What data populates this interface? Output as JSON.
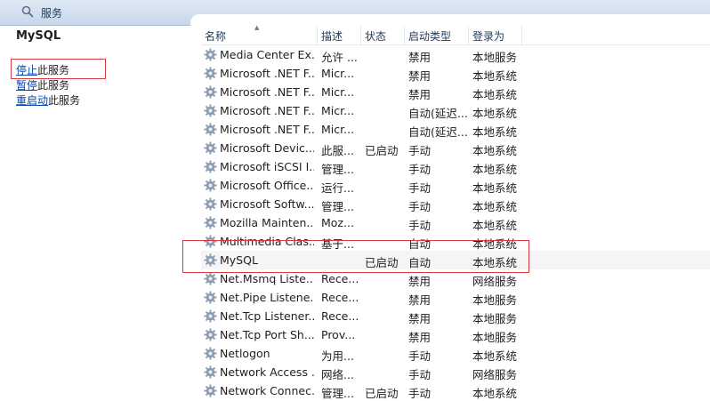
{
  "window": {
    "title": "服务"
  },
  "left_panel": {
    "service_name": "MySQL",
    "actions": [
      {
        "link": "停止",
        "rest": "此服务"
      },
      {
        "link": "暂停",
        "rest": "此服务"
      },
      {
        "link": "重启动",
        "rest": "此服务"
      }
    ]
  },
  "table": {
    "headers": {
      "name": "名称",
      "desc": "描述",
      "state": "状态",
      "startup": "启动类型",
      "logon": "登录为"
    },
    "rows": [
      {
        "name": "Media Center Ex...",
        "desc": "允许 ...",
        "state": "",
        "startup": "禁用",
        "logon": "本地服务"
      },
      {
        "name": "Microsoft .NET F...",
        "desc": "Micr...",
        "state": "",
        "startup": "禁用",
        "logon": "本地系统"
      },
      {
        "name": "Microsoft .NET F...",
        "desc": "Micr...",
        "state": "",
        "startup": "禁用",
        "logon": "本地系统"
      },
      {
        "name": "Microsoft .NET F...",
        "desc": "Micr...",
        "state": "",
        "startup": "自动(延迟...",
        "logon": "本地系统"
      },
      {
        "name": "Microsoft .NET F...",
        "desc": "Micr...",
        "state": "",
        "startup": "自动(延迟...",
        "logon": "本地系统"
      },
      {
        "name": "Microsoft Devic...",
        "desc": "此服...",
        "state": "已启动",
        "startup": "手动",
        "logon": "本地系统"
      },
      {
        "name": "Microsoft iSCSI I...",
        "desc": "管理...",
        "state": "",
        "startup": "手动",
        "logon": "本地系统"
      },
      {
        "name": "Microsoft Office...",
        "desc": "运行...",
        "state": "",
        "startup": "手动",
        "logon": "本地系统"
      },
      {
        "name": "Microsoft Softw...",
        "desc": "管理...",
        "state": "",
        "startup": "手动",
        "logon": "本地系统"
      },
      {
        "name": "Mozilla Mainten...",
        "desc": "Moz...",
        "state": "",
        "startup": "手动",
        "logon": "本地系统"
      },
      {
        "name": "Multimedia Clas...",
        "desc": "基于...",
        "state": "",
        "startup": "自动",
        "logon": "本地系统"
      },
      {
        "name": "MySQL",
        "desc": "",
        "state": "已启动",
        "startup": "自动",
        "logon": "本地系统"
      },
      {
        "name": "Net.Msmq Liste...",
        "desc": "Rece...",
        "state": "",
        "startup": "禁用",
        "logon": "网络服务"
      },
      {
        "name": "Net.Pipe Listene...",
        "desc": "Rece...",
        "state": "",
        "startup": "禁用",
        "logon": "本地服务"
      },
      {
        "name": "Net.Tcp Listener...",
        "desc": "Rece...",
        "state": "",
        "startup": "禁用",
        "logon": "本地服务"
      },
      {
        "name": "Net.Tcp Port Sh...",
        "desc": "Prov...",
        "state": "",
        "startup": "禁用",
        "logon": "本地服务"
      },
      {
        "name": "Netlogon",
        "desc": "为用...",
        "state": "",
        "startup": "手动",
        "logon": "本地系统"
      },
      {
        "name": "Network Access ...",
        "desc": "网络...",
        "state": "",
        "startup": "手动",
        "logon": "网络服务"
      },
      {
        "name": "Network Connec...",
        "desc": "管理...",
        "state": "已启动",
        "startup": "手动",
        "logon": "本地系统"
      }
    ]
  },
  "icons": {
    "title": "search-icon",
    "service": "gear-icon",
    "sort": "sort-up-icon"
  },
  "colors": {
    "highlight_box": "#d8383f",
    "link": "#0645ad",
    "header_text": "#1e395b"
  }
}
